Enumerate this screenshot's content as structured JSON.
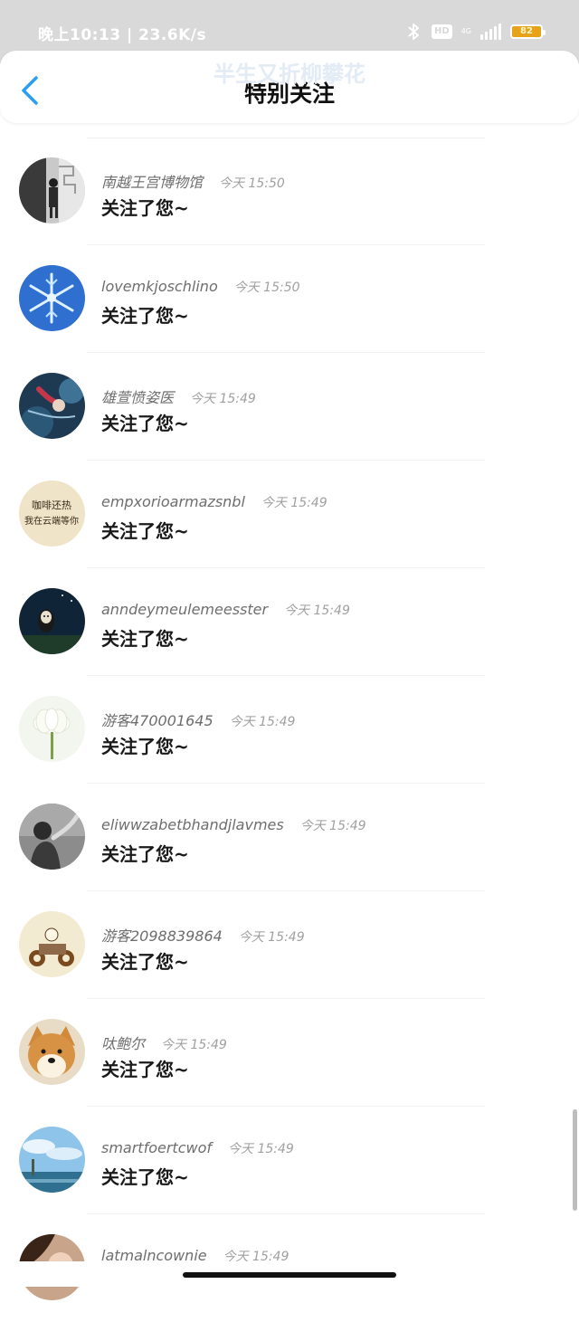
{
  "status_bar": {
    "left_text": "晚上10:13 | 23.6K/s",
    "hd": "HD",
    "network": "4G",
    "battery": "82",
    "battery_color": "#e8a21a"
  },
  "nav": {
    "ghost_title": "半生又折柳攀花",
    "title": "特别关注",
    "back_icon": "chevron-left-icon",
    "accent_color": "#2a9df4"
  },
  "items": [
    {
      "user": "南越王宫博物馆",
      "time": "今天 15:50",
      "message": "关注了您~"
    },
    {
      "user": "lovemkjoschlino",
      "time": "今天 15:50",
      "message": "关注了您~"
    },
    {
      "user": "雄萱愤姿医",
      "time": "今天 15:49",
      "message": "关注了您~"
    },
    {
      "user": "empxorioarmazsnbl",
      "time": "今天 15:49",
      "message": "关注了您~"
    },
    {
      "user": "anndeymeulemeesster",
      "time": "今天 15:49",
      "message": "关注了您~"
    },
    {
      "user": "游客470001645",
      "time": "今天 15:49",
      "message": "关注了您~"
    },
    {
      "user": "eliwwzabetbhandjlavmes",
      "time": "今天 15:49",
      "message": "关注了您~"
    },
    {
      "user": "游客2098839864",
      "time": "今天 15:49",
      "message": "关注了您~"
    },
    {
      "user": "呔鲍尔",
      "time": "今天 15:49",
      "message": "关注了您~"
    },
    {
      "user": "smartfoertcwof",
      "time": "今天 15:49",
      "message": "关注了您~"
    },
    {
      "user": "latmalncownie",
      "time": "今天 15:49",
      "message": ""
    }
  ],
  "avatar_text": {
    "item_4_line1": "咖啡还热",
    "item_4_line2": "我在云端等你"
  }
}
